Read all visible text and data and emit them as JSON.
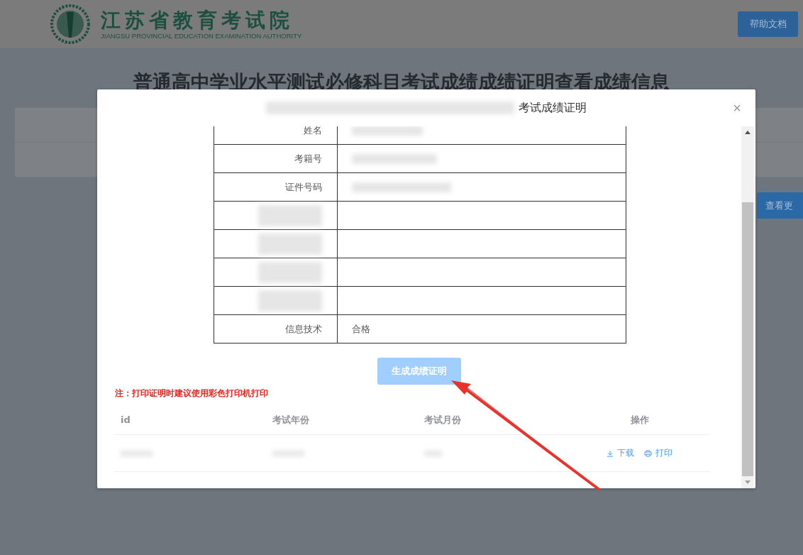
{
  "header": {
    "logo_title": "江苏省教育考试院",
    "logo_subtitle": "JIANGSU PROVINCIAL EDUCATION EXAMINATION AUTHORITY",
    "help_button": "帮助文档"
  },
  "page": {
    "title": "普通高中学业水平测试必修科目考试成绩成绩证明查看成绩信息",
    "more_button": "查看更"
  },
  "dialog": {
    "title": "考试成绩证明",
    "close": "×",
    "certificate_rows": [
      {
        "kind": "field",
        "label": "姓名"
      },
      {
        "kind": "field",
        "label": "考籍号"
      },
      {
        "kind": "field",
        "label": "证件号码"
      },
      {
        "kind": "redacted"
      },
      {
        "kind": "redacted"
      },
      {
        "kind": "redacted"
      },
      {
        "kind": "redacted"
      },
      {
        "kind": "field",
        "label": "信息技术",
        "value": "合格"
      }
    ],
    "generate_button": {
      "label": "生成成绩证明",
      "disabled": true
    },
    "note": "注：打印证明时建议使用彩色打印机打印",
    "records": {
      "columns": [
        "id",
        "考试年份",
        "考试月份",
        "操作"
      ],
      "rows": [
        {
          "actions": [
            {
              "kind": "download",
              "label": "下载"
            },
            {
              "kind": "print",
              "label": "打印"
            }
          ]
        }
      ]
    }
  }
}
